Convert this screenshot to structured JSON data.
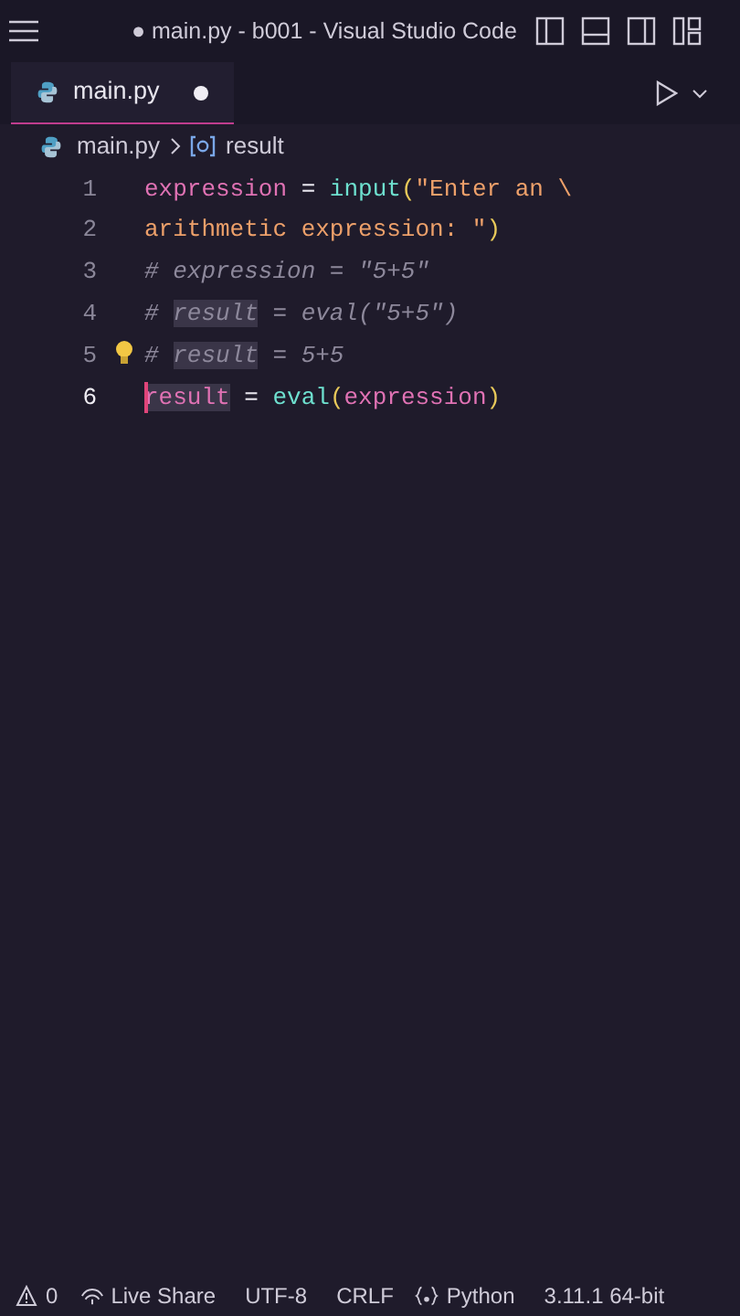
{
  "window": {
    "title": "● main.py - b001 - Visual Studio Code"
  },
  "tabs": [
    {
      "label": "main.py",
      "selected": true,
      "modified": true
    }
  ],
  "breadcrumb": [
    "main.py",
    "result"
  ],
  "editor": {
    "lines": [
      {
        "number": "1",
        "current": false,
        "lightbulb": false,
        "tokens": [
          {
            "text": "expression",
            "kind": "var"
          },
          {
            "text": " = ",
            "kind": "op"
          },
          {
            "text": "input",
            "kind": "func"
          },
          {
            "text": "(",
            "kind": "paren"
          },
          {
            "text": "\"Enter an \\",
            "kind": "str"
          }
        ]
      },
      {
        "number": "2",
        "current": false,
        "lightbulb": false,
        "tokens": [
          {
            "text": "arithmetic expression: \"",
            "kind": "str"
          },
          {
            "text": ")",
            "kind": "paren"
          }
        ]
      },
      {
        "number": "3",
        "current": false,
        "lightbulb": false,
        "tokens": [
          {
            "text": "# expression = \"5+5\"",
            "kind": "comment"
          }
        ]
      },
      {
        "number": "4",
        "current": false,
        "lightbulb": false,
        "tokens": [
          {
            "text": "# ",
            "kind": "comment"
          },
          {
            "text": "result",
            "kind": "comment",
            "highlight": true
          },
          {
            "text": " = eval(\"5+5\")",
            "kind": "comment"
          }
        ]
      },
      {
        "number": "5",
        "current": false,
        "lightbulb": true,
        "tokens": [
          {
            "text": "# ",
            "kind": "comment"
          },
          {
            "text": "result",
            "kind": "comment",
            "highlight": true
          },
          {
            "text": " = 5+5",
            "kind": "comment"
          }
        ]
      },
      {
        "number": "6",
        "current": true,
        "lightbulb": false,
        "tokens": [
          {
            "text": "result",
            "kind": "var",
            "highlight": true
          },
          {
            "text": " = ",
            "kind": "op"
          },
          {
            "text": "eval",
            "kind": "func"
          },
          {
            "text": "(",
            "kind": "paren"
          },
          {
            "text": "expression",
            "kind": "var"
          },
          {
            "text": ")",
            "kind": "paren"
          }
        ]
      }
    ]
  },
  "status_bar": [
    {
      "text": "0",
      "kind": "problems"
    },
    {
      "text": "Live Share",
      "kind": "liveshare"
    },
    {
      "text": "UTF-8",
      "kind": "plain"
    },
    {
      "text": "CRLF",
      "kind": "plain"
    },
    {
      "text": "Python",
      "kind": "language"
    },
    {
      "text": "3.11.1 64-bit",
      "kind": "plain"
    }
  ]
}
